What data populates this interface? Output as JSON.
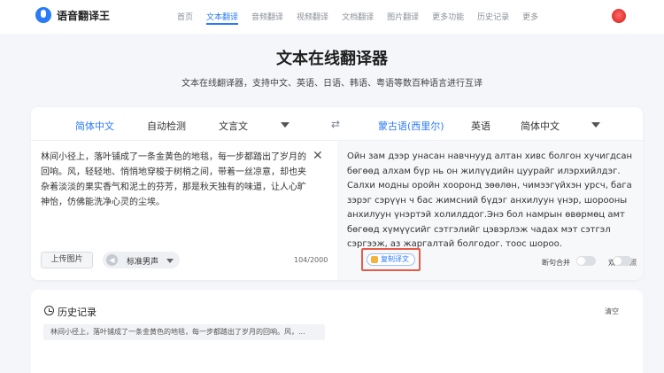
{
  "header": {
    "logo_text": "语音翻译王",
    "nav": [
      "首页",
      "文本翻译",
      "音频翻译",
      "视频翻译",
      "文档翻译",
      "图片翻译",
      "更多功能",
      "历史记录",
      "更多"
    ],
    "active_nav": "文本翻译"
  },
  "page": {
    "title": "文本在线翻译器",
    "subtitle": "文本在线翻译器，支持中文、英语、日语、韩语、粤语等数百种语言进行互译"
  },
  "source_langs": [
    "简体中文",
    "自动检测",
    "文言文"
  ],
  "target_langs": [
    "蒙古语(西里尔)",
    "英语",
    "简体中文"
  ],
  "source": {
    "text": "林间小径上，落叶铺成了一条金黄色的地毯，每一步都踏出了岁月的回响。风，轻轻地、悄悄地穿梭于树梢之间，带着一丝凉意，却也夹杂着淡淡的果实香气和泥土的芬芳，那是秋天独有的味道，让人心旷神怡，仿佛能洗净心灵的尘埃。",
    "upload_label": "上传图片",
    "voice_label": "标准男声",
    "char_count": "104/2000"
  },
  "target": {
    "text": "Ойн зам дээр унасан навчнууд алтан хивс болгон хучигдсан бөгөөд алхам бүр нь он жилүүдийн цуурайг илэрхийлдэг. Салхи модны оройн хооронд зөөлөн, чимээгүйхэн урсч, бага зэрэг сэрүүн ч бас жимсний бүдэг анхилуун үнэр, шорооны анхилуун үнэртэй холилддог.Энэ бол намрын өвөрмөц амт бөгөөд хүмүүсийг сэтгэлийг цэвэрлэж чадах мэт сэтгэл сэргээж, аз жаргалтай болгодог. тоос шороо.",
    "copy_label": "复制译文",
    "toggle1_label": "断句合并",
    "toggle2_label": "双语对照"
  },
  "history": {
    "title": "历史记录",
    "clear_label": "清空",
    "items": [
      "林间小径上，落叶铺成了一条金黄色的地毯，每一步都踏出了岁月的回响。风，..."
    ]
  },
  "colors": {
    "accent": "#2a7bf6",
    "highlight": "#e55b4a"
  }
}
